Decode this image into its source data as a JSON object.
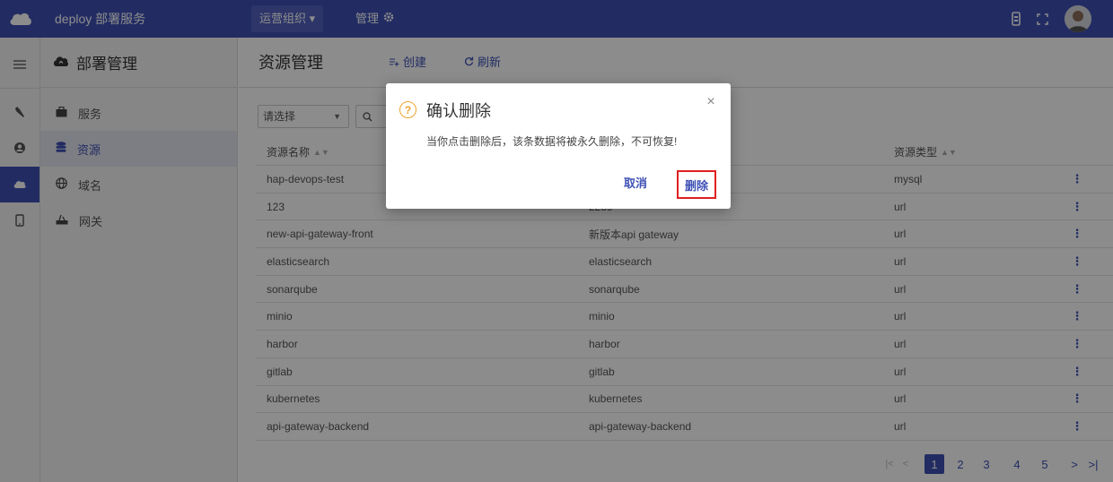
{
  "topbar": {
    "app_title": "deploy 部署服务",
    "org_select": "运营组织",
    "manage_label": "管理"
  },
  "menu": {
    "header": "部署管理",
    "items": [
      {
        "label": "服务",
        "icon": "briefcase-icon"
      },
      {
        "label": "资源",
        "icon": "database-icon"
      },
      {
        "label": "域名",
        "icon": "globe-icon"
      },
      {
        "label": "网关",
        "icon": "gateway-icon"
      }
    ],
    "active_index": 1
  },
  "main": {
    "title": "资源管理",
    "create_label": "创建",
    "refresh_label": "刷新",
    "filter_placeholder": "请选择"
  },
  "table": {
    "headers": [
      "资源名称",
      "",
      "资源类型"
    ],
    "rows": [
      [
        "hap-devops-test",
        "",
        "mysql"
      ],
      [
        "123",
        "2239",
        "url"
      ],
      [
        "new-api-gateway-front",
        "新版本api gateway",
        "url"
      ],
      [
        "elasticsearch",
        "elasticsearch",
        "url"
      ],
      [
        "sonarqube",
        "sonarqube",
        "url"
      ],
      [
        "minio",
        "minio",
        "url"
      ],
      [
        "harbor",
        "harbor",
        "url"
      ],
      [
        "gitlab",
        "gitlab",
        "url"
      ],
      [
        "kubernetes",
        "kubernetes",
        "url"
      ],
      [
        "api-gateway-backend",
        "api-gateway-backend",
        "url"
      ]
    ]
  },
  "pagination": {
    "pages": [
      "1",
      "2",
      "3",
      "4",
      "5"
    ],
    "current": "1"
  },
  "dialog": {
    "title": "确认删除",
    "message": "当你点击删除后，该条数据将被永久删除，不可恢复!",
    "cancel_label": "取消",
    "delete_label": "删除"
  },
  "colors": {
    "primary": "#3f51b5",
    "warning": "#f0a232",
    "highlight_border": "#e02020"
  }
}
